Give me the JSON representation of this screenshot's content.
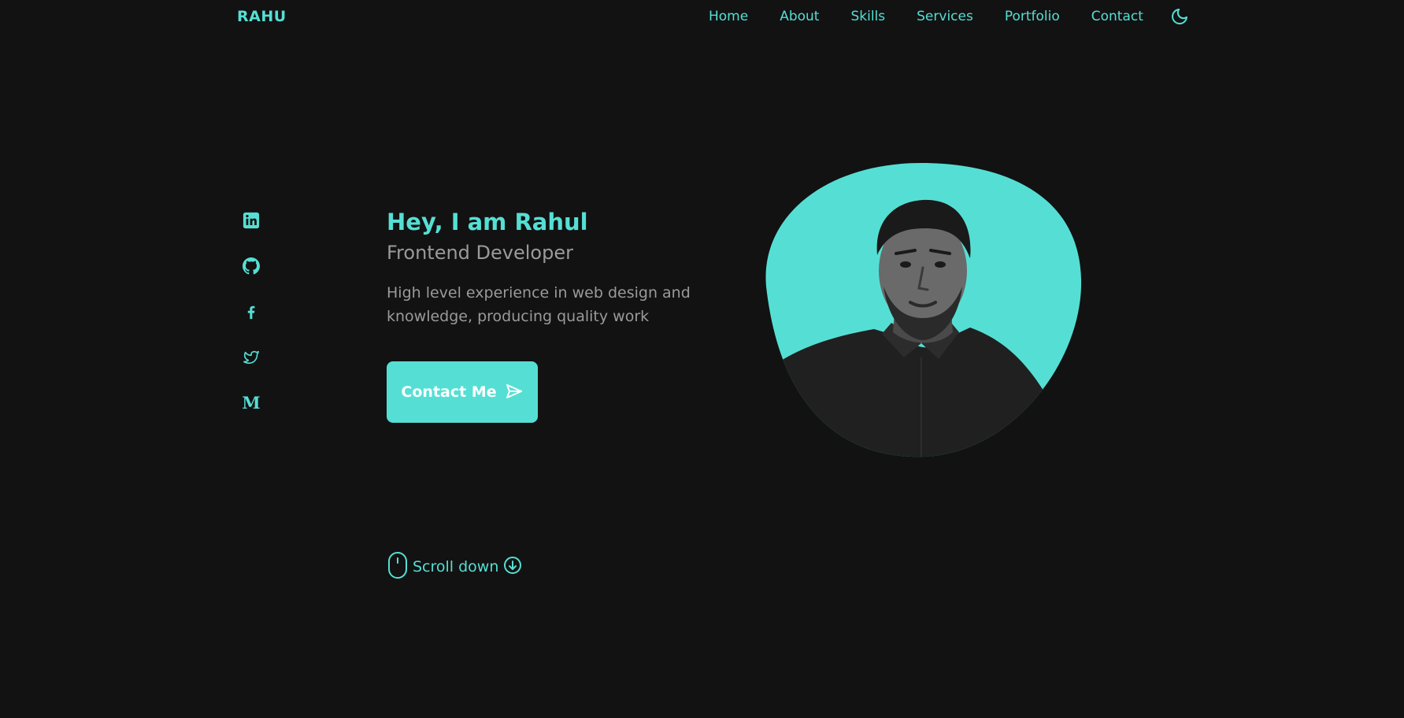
{
  "brand": {
    "logo": "RAHU"
  },
  "nav": {
    "items": [
      {
        "label": "Home"
      },
      {
        "label": "About"
      },
      {
        "label": "Skills"
      },
      {
        "label": "Services"
      },
      {
        "label": "Portfolio"
      },
      {
        "label": "Contact"
      }
    ],
    "theme_toggle_icon": "moon-icon"
  },
  "social": {
    "icons": [
      "linkedin-icon",
      "github-icon",
      "facebook-icon",
      "twitter-icon",
      "medium-icon"
    ]
  },
  "hero": {
    "title": "Hey, I am Rahul",
    "subtitle": "Frontend Developer",
    "description": "High level experience in web design and knowledge, producing quality work",
    "button_label": "Contact Me",
    "button_icon": "send-icon"
  },
  "scroll": {
    "label": "Scroll down",
    "mouse_icon": "mouse-icon",
    "arrow_icon": "arrow-down-circle-icon"
  },
  "colors": {
    "background": "#121212",
    "accent": "#55dfd4",
    "muted_text": "#9a9a9a"
  }
}
